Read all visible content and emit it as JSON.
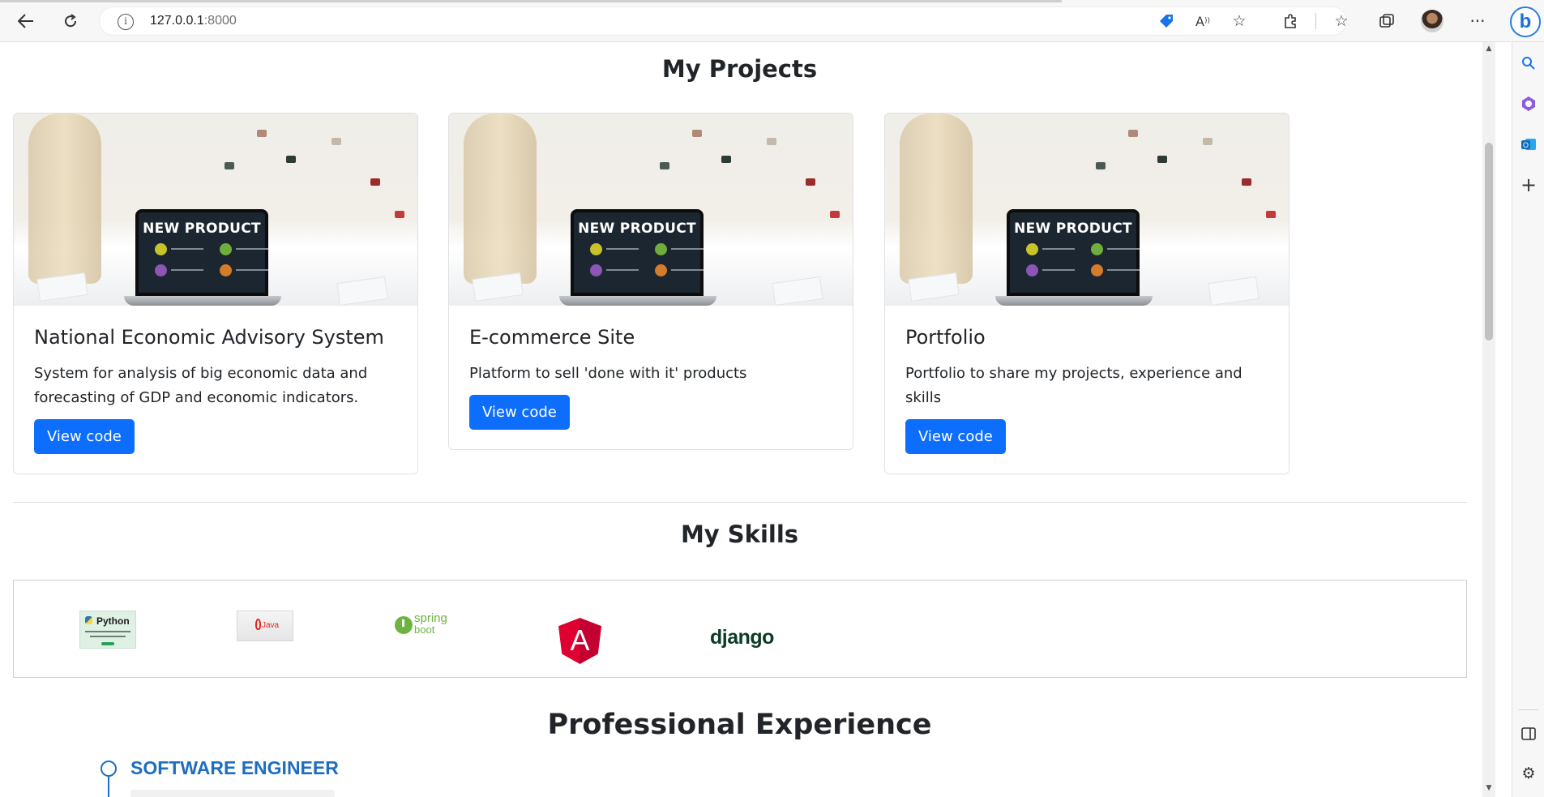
{
  "browser": {
    "url_host": "127.0.0.1",
    "url_port": ":8000",
    "back_icon": "arrow-left-icon",
    "refresh_icon": "refresh-icon",
    "info_icon": "info-icon",
    "toolbar_icons": [
      "tag-icon",
      "read-aloud-icon",
      "add-favorite-icon",
      "extensions-icon",
      "favorites-icon",
      "collections-icon",
      "profile-avatar",
      "more-icon",
      "bing-icon"
    ],
    "sidebar_icons": [
      "search-icon",
      "copilot-icon",
      "outlook-icon",
      "add-icon",
      "panel-icon",
      "settings-icon"
    ]
  },
  "projects": {
    "heading": "My Projects",
    "image_caption": "NEW PRODUCT",
    "items": [
      {
        "title": "National Economic Advisory System",
        "description": "System for analysis of big economic data and forecasting of GDP and economic indicators.",
        "button": "View code"
      },
      {
        "title": "E-commerce Site",
        "description": "Platform to sell 'done with it' products",
        "button": "View code"
      },
      {
        "title": "Portfolio",
        "description": "Portfolio to share my projects, experience and skills",
        "button": "View code"
      }
    ]
  },
  "skills": {
    "heading": "My Skills",
    "logos": [
      {
        "name": "Python",
        "text": "Python"
      },
      {
        "name": "Java",
        "text": "Java"
      },
      {
        "name": "Spring Boot",
        "text_top": "spring",
        "text_bottom": "boot"
      },
      {
        "name": "Angular",
        "text": "A"
      },
      {
        "name": "Django",
        "text": "django"
      }
    ]
  },
  "experience": {
    "heading": "Professional Experience",
    "first_role": "SOFTWARE ENGINEER"
  },
  "colors": {
    "primary_button": "#0d6efd",
    "timeline_accent": "#1e6ec0",
    "angular_red": "#dd0031",
    "spring_green": "#6db33f",
    "django_green": "#0c3c26"
  }
}
